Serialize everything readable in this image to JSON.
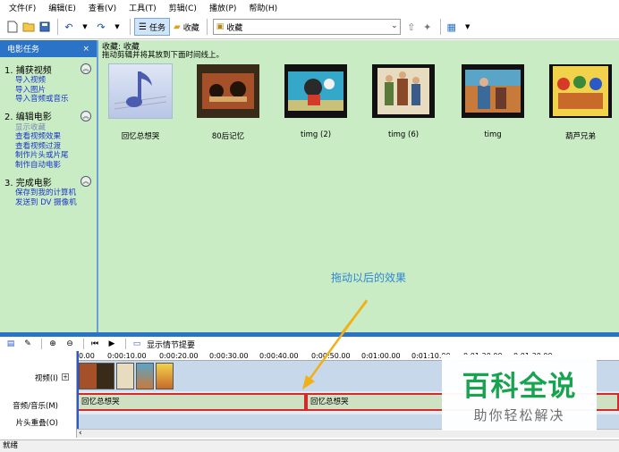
{
  "menu": [
    "文件(F)",
    "编辑(E)",
    "查看(V)",
    "工具(T)",
    "剪辑(C)",
    "播放(P)",
    "帮助(H)"
  ],
  "toolbar": {
    "tasks_label": "任务",
    "collections_label": "收藏",
    "combo_value": "收藏"
  },
  "taskpane": {
    "header": "电影任务",
    "close": "×",
    "sections": [
      {
        "title": "1. 捕获视频",
        "links": [
          "导入视频",
          "导入图片",
          "导入音频或音乐"
        ]
      },
      {
        "title": "2. 编辑电影",
        "links": [
          "显示收藏",
          "查看视频效果",
          "查看视频过渡",
          "制作片头或片尾",
          "制作自动电影"
        ]
      },
      {
        "title": "3. 完成电影",
        "links": [
          "保存到我的计算机",
          "发送到 DV 摄像机"
        ]
      }
    ]
  },
  "collection": {
    "title": "收藏: 收藏",
    "subtitle": "拖动剪辑并将其放到下面时间线上。",
    "clips": [
      {
        "name": "回忆总想哭",
        "kind": "audio"
      },
      {
        "name": "80后记忆",
        "kind": "video"
      },
      {
        "name": "timg (2)",
        "kind": "video"
      },
      {
        "name": "timg (6)",
        "kind": "video"
      },
      {
        "name": "timg",
        "kind": "video"
      },
      {
        "name": "葫芦兄弟",
        "kind": "video"
      }
    ]
  },
  "annotation": "拖动以后的效果",
  "timeline": {
    "storyboard_toggle": "显示情节提要",
    "ruler": [
      "0.00",
      "0:00:10.00",
      "0:00:20.00",
      "0:00:30.00",
      "0:00:40.00",
      "0:00:50.00",
      "0:01:00.00",
      "0:01:10.00",
      "0:01:20.00",
      "0:01:30.00"
    ],
    "tracks": {
      "video": "视频(I)",
      "audio": "音频/音乐(M)",
      "title": "片头重叠(O)"
    },
    "audio_clips": [
      "回忆总想哭",
      "回忆总想哭"
    ]
  },
  "status": "就绪",
  "watermark": {
    "line1": "百科全说",
    "line2": "助你轻松解决"
  },
  "colors": {
    "accent": "#2b73c7",
    "pane_bg": "#c9ecc4",
    "link": "#1a35c9",
    "audio_border": "#d42a2a",
    "watermark_green": "#18a34f"
  }
}
